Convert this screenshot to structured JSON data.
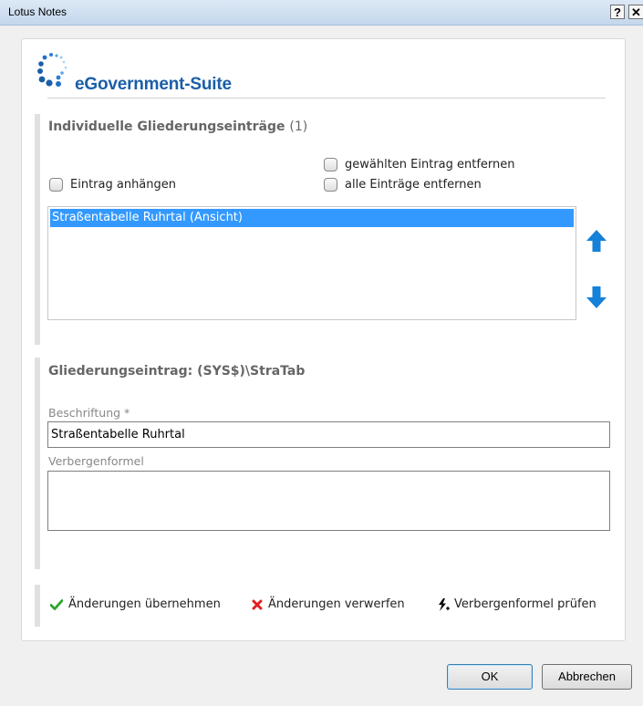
{
  "window": {
    "title": "Lotus Notes",
    "help_label": "?",
    "close_label": "✕"
  },
  "brand": {
    "name": "eGovernment-Suite",
    "color": "#1a5ea8"
  },
  "entries_section": {
    "title": "Individuelle Gliederungseinträge",
    "count": "(1)",
    "options": {
      "append": "Eintrag anhängen",
      "remove_selected": "gewählten Eintrag entfernen",
      "remove_all": "alle Einträge entfernen"
    },
    "items": [
      {
        "label": "Straßentabelle Ruhrtal (Ansicht)",
        "selected": true
      }
    ],
    "arrow_color": "#1581d8"
  },
  "entry_section": {
    "title": "Gliederungseintrag:  (SYS$)\\StraTab",
    "caption_label": "Beschriftung *",
    "caption_value": "Straßentabelle Ruhrtal",
    "hide_formula_label": "Verbergenformel",
    "hide_formula_value": ""
  },
  "actions": {
    "apply": "Änderungen übernehmen",
    "discard": "Änderungen verwerfen",
    "check_formula": "Verbergenformel prüfen",
    "apply_icon": "checkmark-icon",
    "discard_icon": "cross-icon",
    "check_icon": "lightning-icon"
  },
  "footer": {
    "ok": "OK",
    "cancel": "Abbrechen"
  },
  "colors": {
    "selection": "#3399ff",
    "apply_green": "#2aa52a",
    "discard_red": "#e02020"
  }
}
